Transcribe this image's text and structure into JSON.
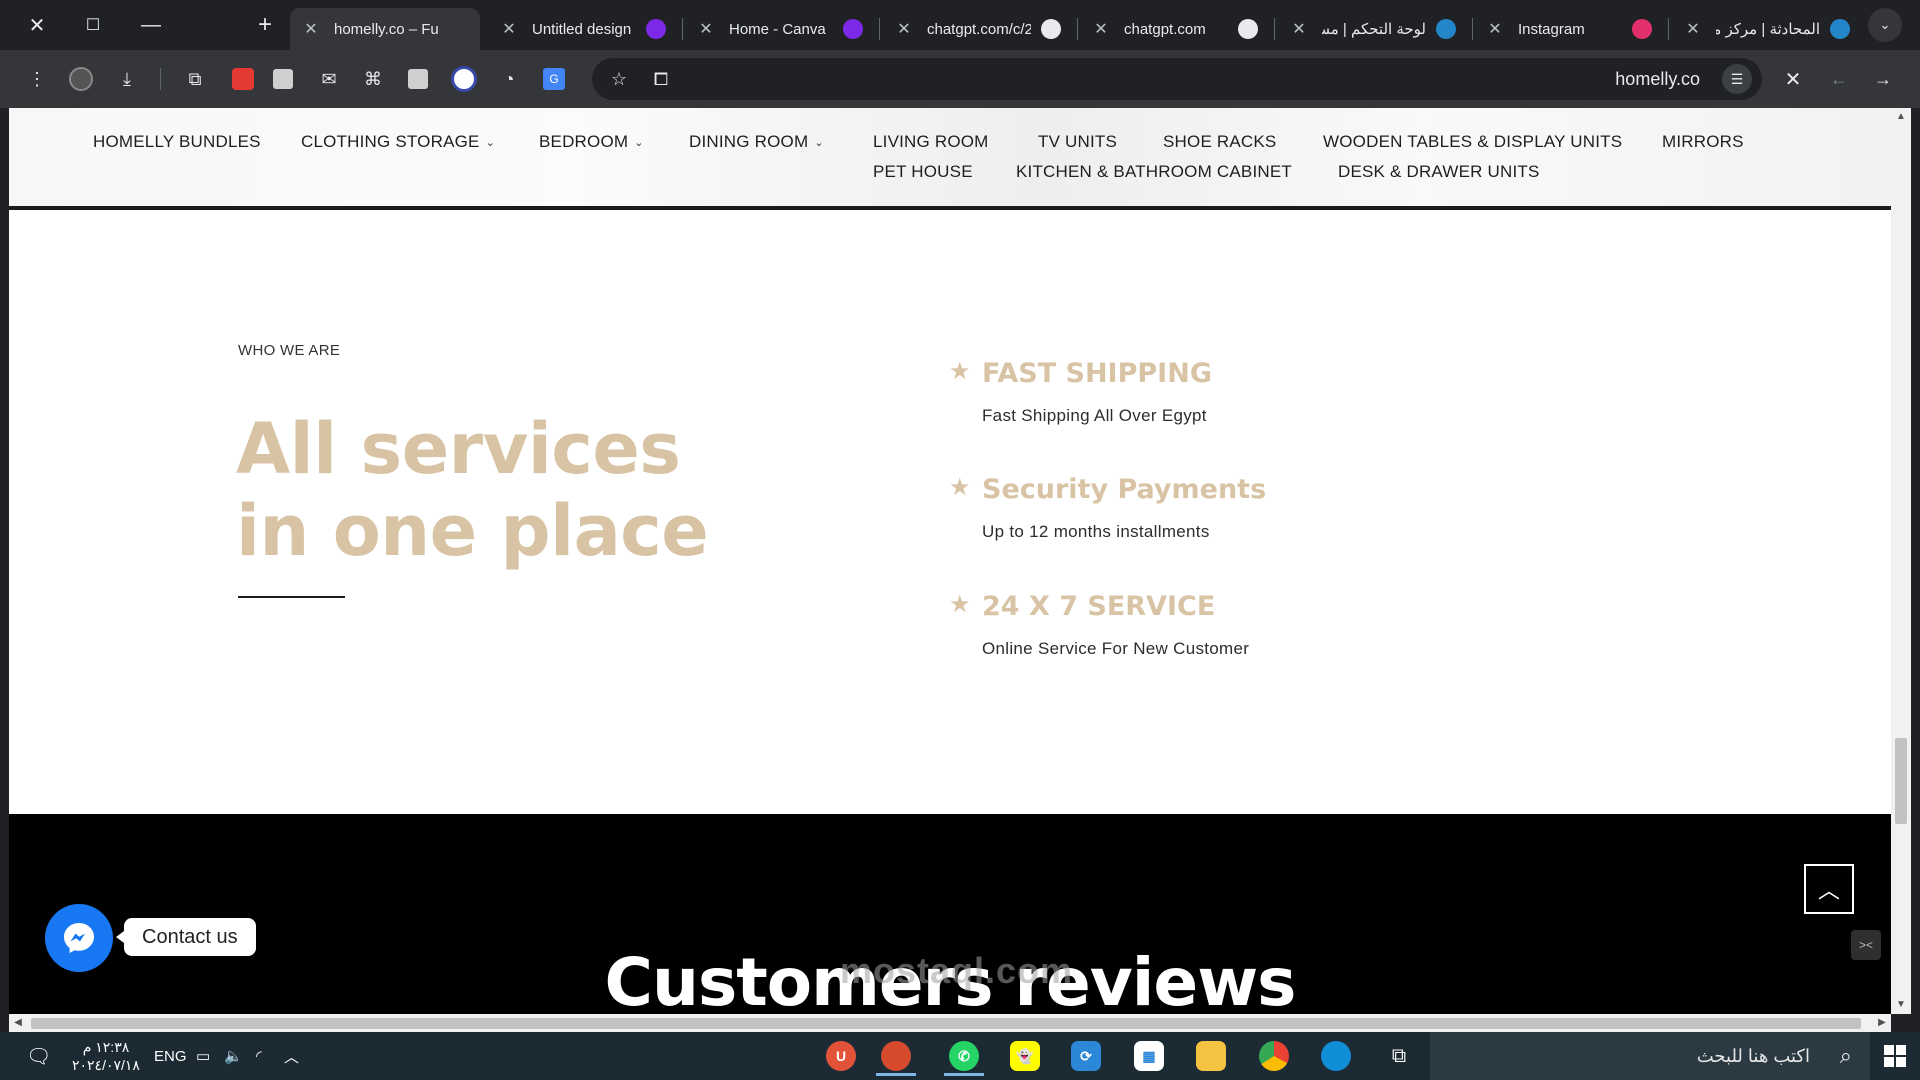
{
  "browser": {
    "tabs": [
      {
        "title": "homelly.co – Fur",
        "icon": "homelly-favicon",
        "color": "#35363a",
        "active": true
      },
      {
        "title": "Untitled design",
        "icon": "canva-icon",
        "color": "#7d2ae8",
        "active": false
      },
      {
        "title": "Home - Canva",
        "icon": "canva-icon",
        "color": "#7d2ae8",
        "active": false
      },
      {
        "title": "chatgpt.com/c/2",
        "icon": "chatgpt-icon",
        "color": "#e8eaed",
        "active": false
      },
      {
        "title": "chatgpt.com",
        "icon": "chatgpt-icon",
        "color": "#e8eaed",
        "active": false
      },
      {
        "title": "لوحة التحكم | مستقل",
        "icon": "mostaql-icon",
        "color": "#2386c8",
        "active": false
      },
      {
        "title": "Instagram",
        "icon": "instagram-icon",
        "color": "#e1306c",
        "active": false
      },
      {
        "title": "المحادثة | مركز مستقل",
        "icon": "mostaql-icon",
        "color": "#2386c8",
        "active": false
      }
    ],
    "url": "homelly.co"
  },
  "site": {
    "nav": {
      "row1": [
        {
          "label": "HOMELLY BUNDLES",
          "dropdown": false
        },
        {
          "label": "CLOTHING STORAGE",
          "dropdown": true
        },
        {
          "label": "BEDROOM",
          "dropdown": true
        },
        {
          "label": "DINING ROOM",
          "dropdown": true
        },
        {
          "label": "LIVING ROOM",
          "dropdown": false
        },
        {
          "label": "TV UNITS",
          "dropdown": false
        },
        {
          "label": "SHOE RACKS",
          "dropdown": false
        },
        {
          "label": "WOODEN TABLES & DISPLAY UNITS",
          "dropdown": false
        },
        {
          "label": "MIRRORS",
          "dropdown": false
        }
      ],
      "row2": [
        {
          "label": "PET HOUSE",
          "dropdown": false
        },
        {
          "label": "KITCHEN & BATHROOM CABINET",
          "dropdown": false
        },
        {
          "label": "DESK & DRAWER UNITS",
          "dropdown": false
        }
      ]
    },
    "about": {
      "kicker": "WHO WE ARE",
      "headline_line1": "All services",
      "headline_line2": "in one place"
    },
    "features": [
      {
        "title": "FAST SHIPPING",
        "desc": "Fast Shipping All Over Egypt"
      },
      {
        "title": "Security Payments",
        "desc": "Up to 12 months installments"
      },
      {
        "title": "24 X 7 SERVICE",
        "desc": "Online Service For New Customer"
      }
    ],
    "reviews_title": "Customers reviews",
    "contact_label": "Contact us",
    "watermark": "mostaql.com"
  },
  "colors": {
    "accent": "#d8c3a5",
    "messenger": "#1877f2"
  },
  "taskbar": {
    "time": "١٢:٣٨ م",
    "date": "٢٠٢٤/٠٧/١٨",
    "language": "ENG",
    "search_placeholder": "اكتب هنا للبحث"
  }
}
